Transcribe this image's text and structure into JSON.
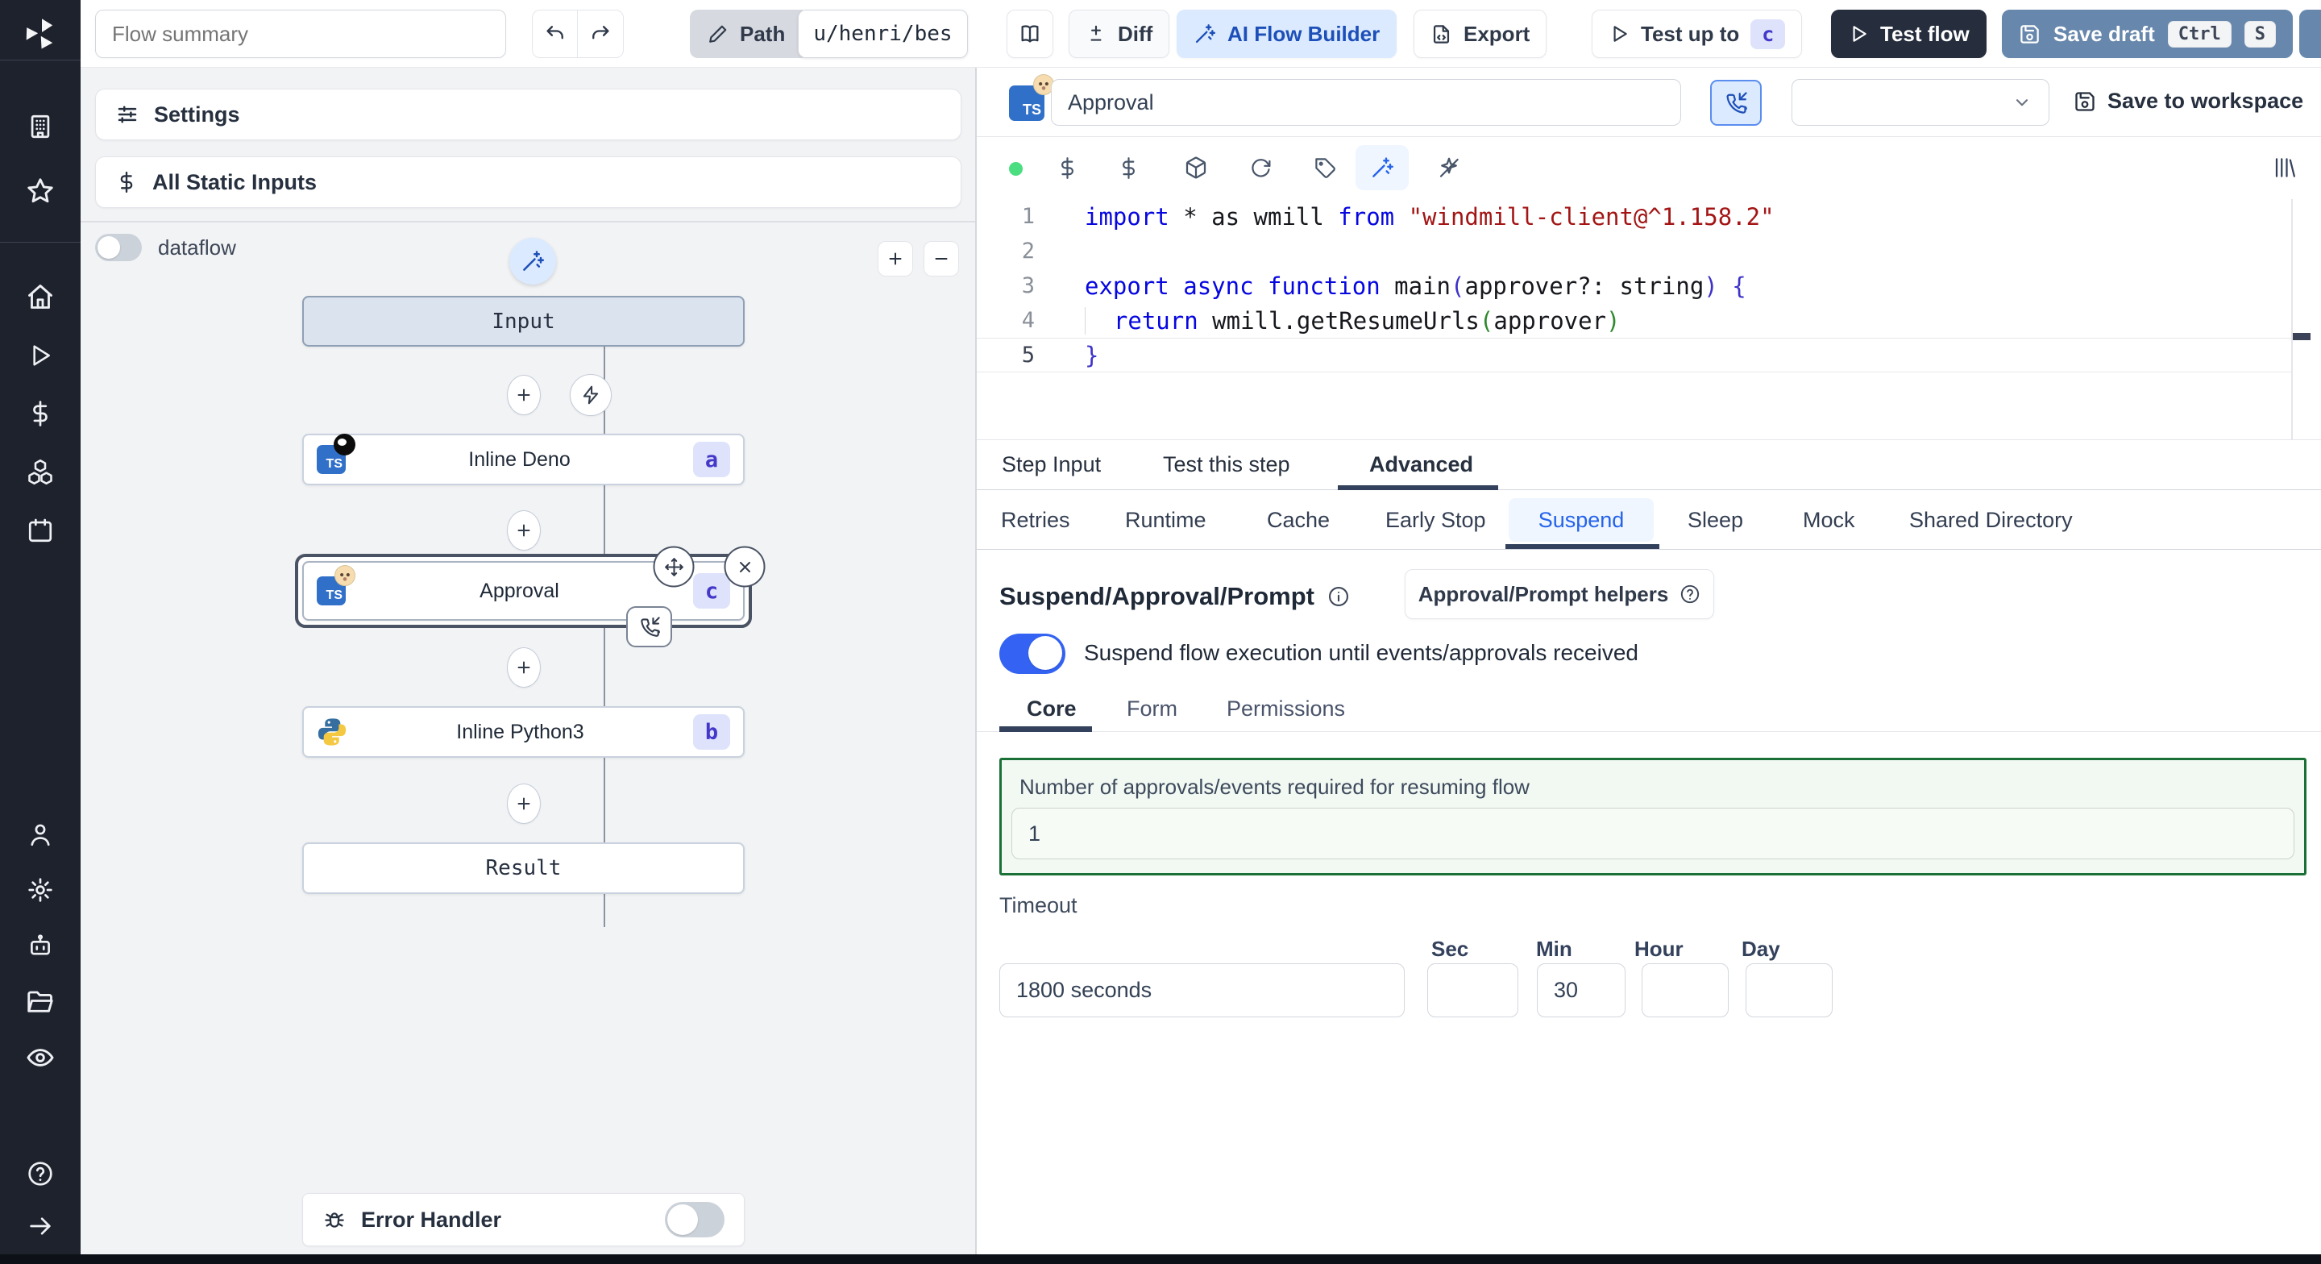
{
  "colors": {
    "rail_bg": "#1e222d",
    "panel_bg": "#f2f3f5",
    "accent_blue": "#2563eb",
    "toggle_on": "#3463f3",
    "ai_builder_bg": "#dbeafe",
    "ai_builder_text": "#1d4fb8",
    "test_flow_bg": "#262d3d",
    "save_draft_bg": "#6787ac",
    "badge_bg": "#dee3fb",
    "badge_text": "#4438c9",
    "selected_node_ring": "#4a5364",
    "approvals_box_border": "#1a7036",
    "code_keyword": "#0606e0",
    "code_string": "#a31515"
  },
  "topbar": {
    "flow_summary_placeholder": "Flow summary",
    "path_label": "Path",
    "path_value": "u/henri/bes",
    "diff_label": "Diff",
    "ai_flow_builder_label": "AI Flow Builder",
    "export_label": "Export",
    "test_up_to_label": "Test up to",
    "test_up_to_badge": "c",
    "test_flow_label": "Test flow",
    "save_draft_label": "Save draft",
    "save_draft_kbd_1": "Ctrl",
    "save_draft_kbd_2": "S"
  },
  "sidebar_icons": [
    "windmill-logo",
    "workspace-building",
    "favorites-star",
    "home",
    "runs-play",
    "variables-dollar",
    "resources-cubes",
    "schedules-calendar",
    "user",
    "settings-gear",
    "workers-robot",
    "folders",
    "audit-eye",
    "help-circle",
    "collapse-arrow-right"
  ],
  "flow_panel": {
    "settings_label": "Settings",
    "all_static_inputs_label": "All Static Inputs",
    "dataflow_label": "dataflow",
    "input_node_label": "Input",
    "result_node_label": "Result",
    "ts_icon_label": "TS",
    "steps": [
      {
        "label": "Inline Deno",
        "badge": "a"
      },
      {
        "label": "Approval",
        "badge": "c"
      },
      {
        "label": "Inline Python3",
        "badge": "b"
      }
    ],
    "error_handler_label": "Error Handler"
  },
  "step_editor": {
    "title_value": "Approval",
    "save_to_workspace_label": "Save to workspace",
    "code": {
      "ln1": "1",
      "ln2": "2",
      "ln3": "3",
      "ln4": "4",
      "ln5": "5",
      "l1": {
        "kw1": "import",
        "t1": " * as wmill ",
        "kw2": "from",
        "t2": " ",
        "str": "\"windmill-client@^1.158.2\""
      },
      "l3": {
        "kw1": "export",
        "t1": " ",
        "kw2": "async",
        "t2": " ",
        "kw3": "function",
        "t3": " main",
        "p1": "(",
        "t4": "approver?: string",
        "p2": ")",
        "t5": " ",
        "b1": "{"
      },
      "l4": {
        "t1": "  ",
        "kw1": "return",
        "t2": " wmill.getResumeUrls",
        "p1": "(",
        "t3": "approver",
        "p2": ")"
      },
      "l5": {
        "b1": "}"
      }
    },
    "tabs": {
      "step_input": "Step Input",
      "test_this_step": "Test this step",
      "advanced": "Advanced"
    },
    "subtabs": {
      "retries": "Retries",
      "runtime": "Runtime",
      "cache": "Cache",
      "early_stop": "Early Stop",
      "suspend": "Suspend",
      "sleep": "Sleep",
      "mock": "Mock",
      "shared_directory": "Shared Directory"
    },
    "suspend": {
      "heading": "Suspend/Approval/Prompt",
      "helpers_button_label": "Approval/Prompt helpers",
      "toggle_label": "Suspend flow execution until events/approvals received",
      "tabs": {
        "core": "Core",
        "form": "Form",
        "permissions": "Permissions"
      },
      "approvals_label": "Number of approvals/events required for resuming flow",
      "approvals_value": "1",
      "timeout_label": "Timeout",
      "timeout_value": "1800 seconds",
      "units": {
        "sec": "Sec",
        "min": "Min",
        "hour": "Hour",
        "day": "Day"
      },
      "sec_value": "",
      "min_value": "30",
      "hour_value": "",
      "day_value": ""
    }
  }
}
